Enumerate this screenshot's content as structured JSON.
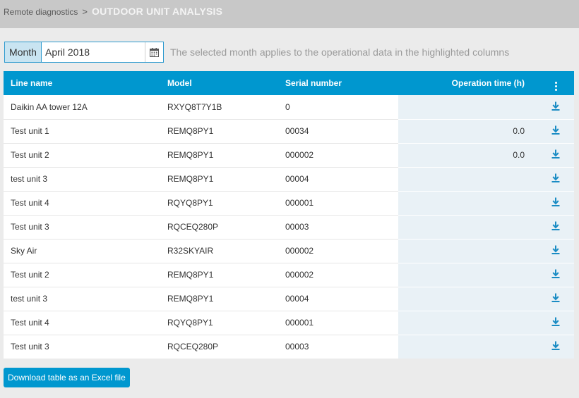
{
  "breadcrumb": {
    "parent": "Remote diagnostics",
    "separator": ">",
    "current": "OUTDOOR UNIT ANALYSIS"
  },
  "month": {
    "label": "Month",
    "value": "April 2018",
    "calendar_icon": "calendar-icon",
    "note": "The selected month applies to the operational data in the highlighted columns"
  },
  "table": {
    "columns": [
      "Line name",
      "Model",
      "Serial number",
      "Operation time (h)"
    ],
    "menu_icon": "more-vertical-icon",
    "download_icon": "download-icon",
    "rows": [
      [
        "Daikin AA tower 12A",
        "RXYQ8T7Y1B",
        "0",
        ""
      ],
      [
        "Test unit 1",
        "REMQ8PY1",
        "00034",
        "0.0"
      ],
      [
        "Test unit 2",
        "REMQ8PY1",
        "000002",
        "0.0"
      ],
      [
        "test unit 3",
        "REMQ8PY1",
        "00004",
        ""
      ],
      [
        "Test unit 4",
        "RQYQ8PY1",
        "000001",
        ""
      ],
      [
        "Test unit 3",
        "RQCEQ280P",
        "00003",
        ""
      ],
      [
        "Sky Air",
        "R32SKYAIR",
        "000002",
        ""
      ],
      [
        "Test unit 2",
        "REMQ8PY1",
        "000002",
        ""
      ],
      [
        "test unit 3",
        "REMQ8PY1",
        "00004",
        ""
      ],
      [
        "Test unit 4",
        "RQYQ8PY1",
        "000001",
        ""
      ],
      [
        "Test unit 3",
        "RQCEQ280P",
        "00003",
        ""
      ]
    ]
  },
  "export_button": "Download table as an Excel file",
  "colors": {
    "accent": "#0097cf",
    "header_bar": "#c8c8c8",
    "highlight_column": "#e9f1f6",
    "page_background": "#ebebeb"
  }
}
